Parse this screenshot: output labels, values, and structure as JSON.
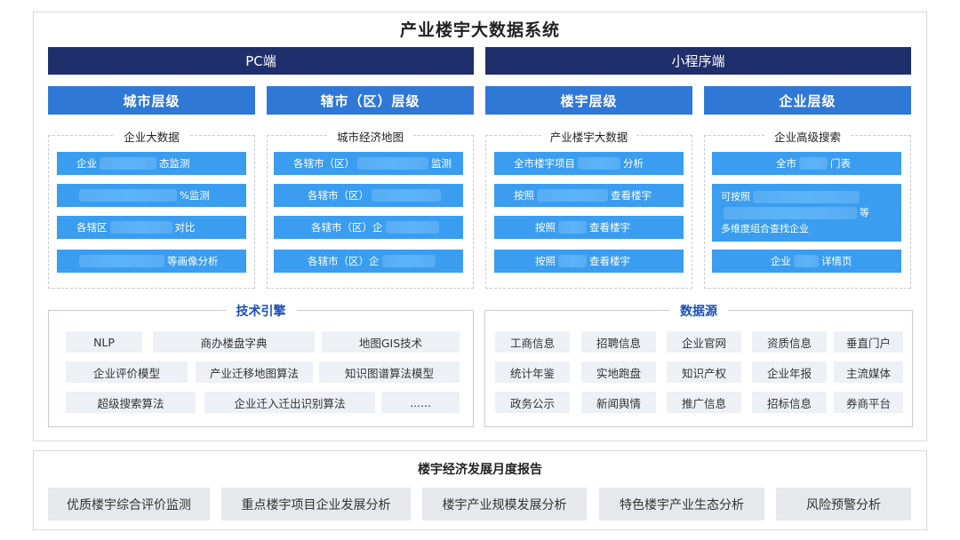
{
  "title": "产业楼宇大数据系统",
  "platforms": {
    "pc": "PC端",
    "mini": "小程序端"
  },
  "levels": [
    "城市层级",
    "辖市（区）层级",
    "楼宇层级",
    "企业层级"
  ],
  "modules": [
    {
      "title": "企业大数据",
      "items": [
        {
          "pre": "企业",
          "post": "态监测"
        },
        {
          "pre": "",
          "post": "%监测"
        },
        {
          "pre": "各辖区",
          "post": "对比"
        },
        {
          "pre": "",
          "post": "等画像分析"
        }
      ]
    },
    {
      "title": "城市经济地图",
      "items": [
        {
          "pre": "各辖市（区）",
          "post": "监测"
        },
        {
          "pre": "各辖市（区）",
          "post": ""
        },
        {
          "pre": "各辖市（区）企",
          "post": ""
        },
        {
          "pre": "各辖市（区）企",
          "post": ""
        }
      ]
    },
    {
      "title": "产业楼宇大数据",
      "items": [
        {
          "pre": "全市楼宇项目",
          "post": "分析"
        },
        {
          "pre": "按照",
          "post": "查看楼宇"
        },
        {
          "pre": "按照",
          "post": "查看楼宇"
        },
        {
          "pre": "按照",
          "post": "查看楼宇"
        }
      ]
    },
    {
      "title": "企业高级搜索",
      "items": [
        {
          "pre": "全市",
          "post": "门表"
        },
        {
          "lines": [
            "可按照",
            "等",
            "多维度组合查找企业"
          ]
        },
        {
          "pre": "企业",
          "post": "详情页"
        }
      ]
    }
  ],
  "tech_engine": {
    "title": "技术引擎",
    "items": [
      "NLP",
      "商办楼盘字典",
      "地图GIS技术",
      "企业评价模型",
      "产业迁移地图算法",
      "知识图谱算法模型",
      "超级搜索算法",
      "企业迁入迁出识别算法",
      "......"
    ]
  },
  "data_source": {
    "title": "数据源",
    "items": [
      "工商信息",
      "招聘信息",
      "企业官网",
      "资质信息",
      "垂直门户",
      "统计年鉴",
      "实地跑盘",
      "知识产权",
      "企业年报",
      "主流媒体",
      "政务公示",
      "新闻舆情",
      "推广信息",
      "招标信息",
      "券商平台"
    ]
  },
  "report": {
    "title": "楼宇经济发展月度报告",
    "items": [
      "优质楼宇综合评价监测",
      "重点楼宇项目企业发展分析",
      "楼宇产业规模发展分析",
      "特色楼宇产业生态分析",
      "风险预警分析"
    ]
  },
  "colors": {
    "dark_navy": "#1e2f6b",
    "level_blue": "#2f78d6",
    "feature_blue": "#3a9df0",
    "section_title": "#1d4fb8"
  }
}
